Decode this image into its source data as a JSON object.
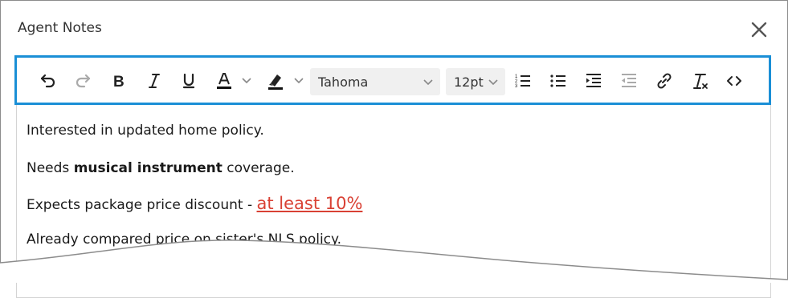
{
  "dialog": {
    "title": "Agent Notes",
    "close_icon": "close-icon"
  },
  "toolbar": {
    "undo_icon": "undo-icon",
    "redo_icon": "redo-icon",
    "bold_icon": "bold-icon",
    "italic_icon": "italic-icon",
    "underline_icon": "underline-icon",
    "text_color_icon": "text-color-icon",
    "highlight_icon": "highlight-icon",
    "font_family": "Tahoma",
    "font_size": "12pt",
    "ordered_list_icon": "ordered-list-icon",
    "bullet_list_icon": "bullet-list-icon",
    "indent_icon": "indent-icon",
    "outdent_icon": "outdent-icon",
    "link_icon": "link-icon",
    "clear_format_icon": "clear-formatting-icon",
    "source_code_icon": "source-code-icon",
    "accent_color": "#1a8fd6"
  },
  "content": {
    "line1": "Interested in updated home policy.",
    "line2_prefix": "Needs ",
    "line2_bold": "musical instrument",
    "line2_suffix": " coverage.",
    "line3_prefix": "Expects package price discount - ",
    "line3_highlight": "at least 10%",
    "line4": "Already compared price on sister's NLS policy.",
    "highlight_color": "#d94134"
  }
}
